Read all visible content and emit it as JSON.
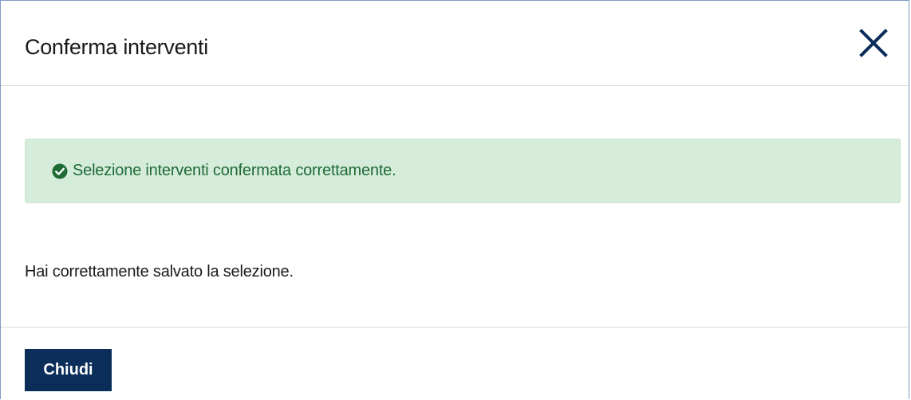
{
  "dialog": {
    "title": "Conferma interventi",
    "close_icon": "close-icon",
    "alert": {
      "icon": "check-circle-icon",
      "message": "Selezione interventi confermata correttamente.",
      "color": "#1f6b34",
      "background": "#d5ecdb"
    },
    "body_text": "Hai correttamente salvato la selezione.",
    "footer": {
      "close_button_label": "Chiudi",
      "button_color": "#0b2d5a"
    }
  }
}
